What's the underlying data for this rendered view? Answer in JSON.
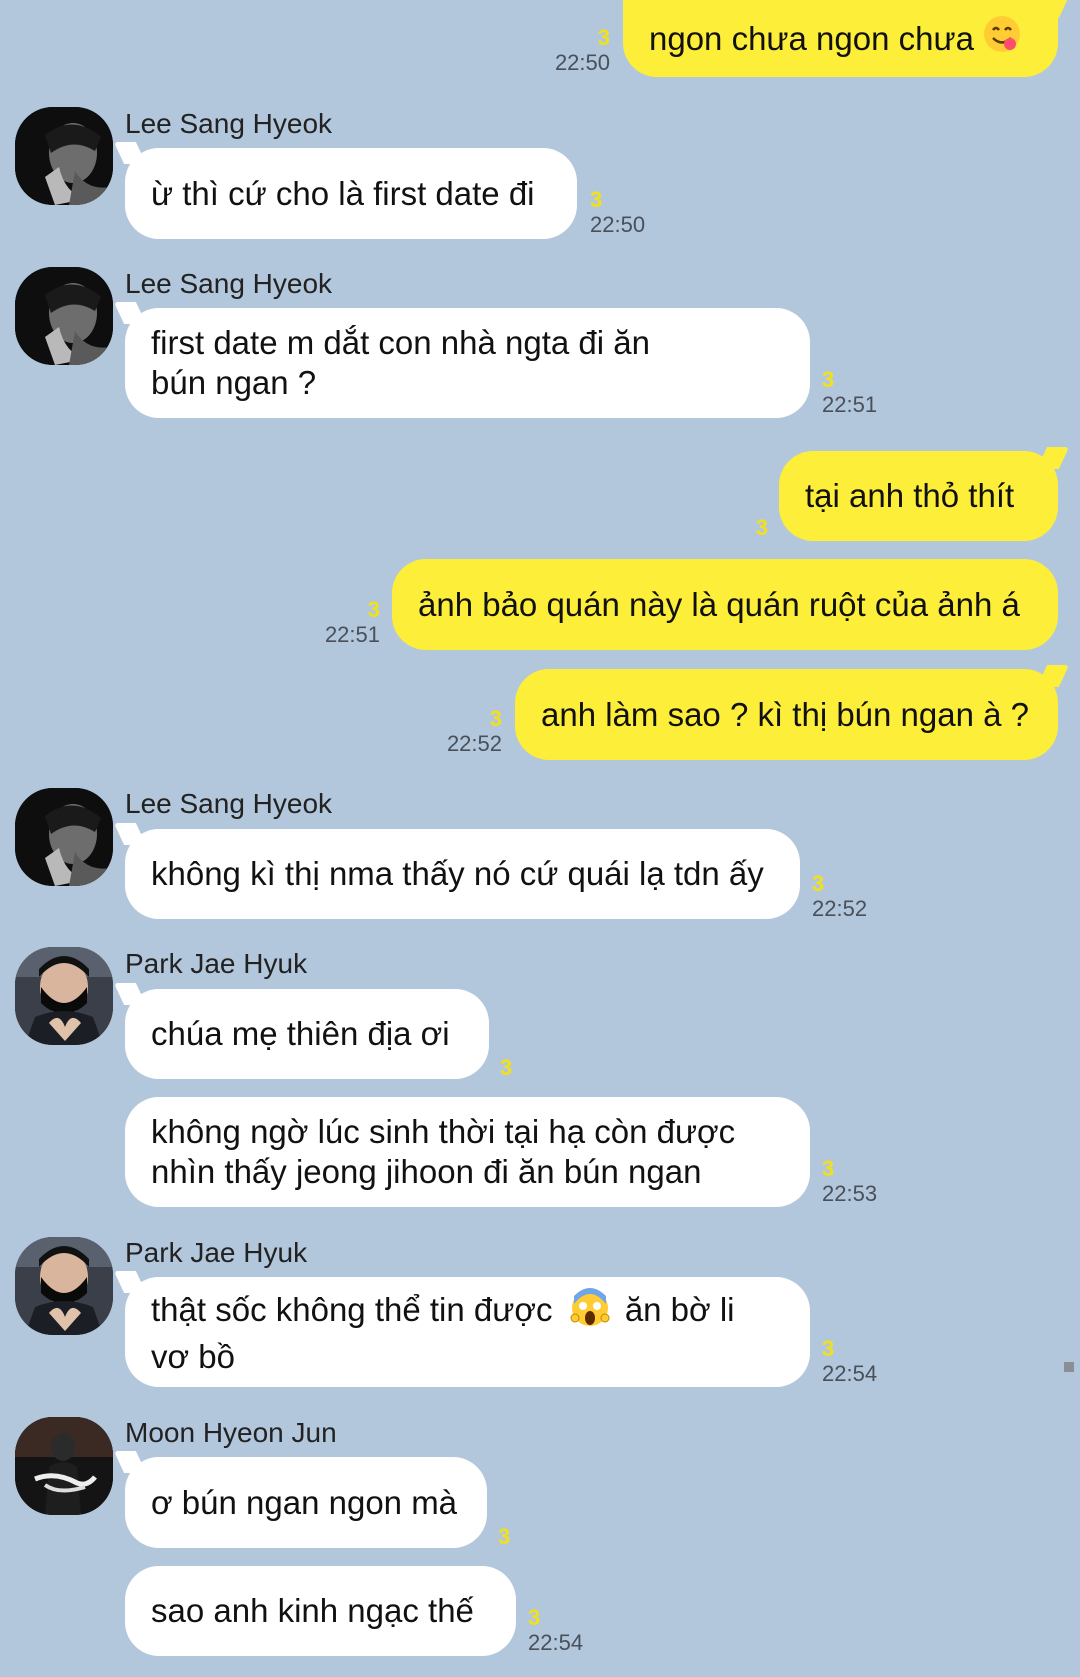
{
  "messages": [
    {
      "text": "ngon chưa ngon chưa",
      "emoji": "😋",
      "unread": "3",
      "time": "22:50"
    },
    {
      "sender": "Lee Sang Hyeok",
      "text": "ừ thì cứ cho là first date đi",
      "unread": "3",
      "time": "22:50"
    },
    {
      "sender": "Lee Sang Hyeok",
      "text": "first date m dắt con nhà ngta đi ăn bún ngan ?",
      "unread": "3",
      "time": "22:51"
    },
    {
      "text": "tại anh thỏ thít",
      "unread": "3"
    },
    {
      "text": "ảnh bảo quán này là quán ruột của ảnh á",
      "unread": "3",
      "time": "22:51"
    },
    {
      "text": "anh làm sao ? kì thị bún ngan à ?",
      "unread": "3",
      "time": "22:52"
    },
    {
      "sender": "Lee Sang Hyeok",
      "text": "không kì thị nma thấy nó cứ quái lạ tdn ấy",
      "unread": "3",
      "time": "22:52"
    },
    {
      "sender": "Park Jae Hyuk",
      "text": "chúa mẹ thiên địa ơi",
      "unread": "3"
    },
    {
      "text": "không ngờ lúc sinh thời tại hạ còn được nhìn thấy jeong jihoon đi ăn bún ngan",
      "unread": "3",
      "time": "22:53"
    },
    {
      "sender": "Park Jae Hyuk",
      "text": "thật sốc không thể tin được",
      "emoji": "😱",
      "text2": "ăn bờ li vơ bồ",
      "unread": "3",
      "time": "22:54"
    },
    {
      "sender": "Moon Hyeon Jun",
      "text": "ơ bún ngan ngon mà",
      "unread": "3"
    },
    {
      "text": "sao anh kinh ngạc thế",
      "unread": "3",
      "time": "22:54"
    }
  ],
  "avatars": [
    {
      "icon": "profile-photo-lee-sang-hyeok"
    },
    {
      "icon": "profile-photo-park-jae-hyuk"
    },
    {
      "icon": "profile-photo-moon-hyeon-jun"
    }
  ],
  "colors": {
    "background": "#b3c7dc",
    "outgoing_bubble": "#fdee3a",
    "incoming_bubble": "#ffffff",
    "unread_count": "#f2e01c"
  }
}
